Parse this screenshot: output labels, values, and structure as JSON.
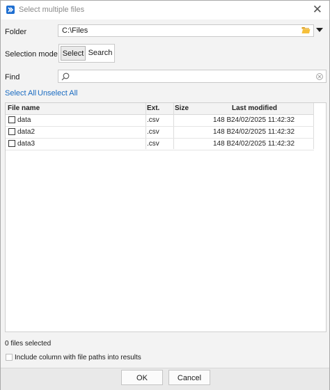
{
  "window": {
    "title": "Select multiple files",
    "close_glyph": "✕"
  },
  "folder": {
    "label": "Folder",
    "value": "C:\\Files",
    "folder_icon": "folder-open-icon",
    "dropdown_icon": "caret-down-icon"
  },
  "selection_mode": {
    "label": "Selection mode",
    "options": [
      "Select",
      "Search"
    ],
    "selected": "Select"
  },
  "find": {
    "label": "Find",
    "value": "",
    "placeholder": ""
  },
  "links": {
    "select_all": "Select All",
    "unselect_all": "Unselect All"
  },
  "table": {
    "columns": [
      "File name",
      "Ext.",
      "Size",
      "Last modified"
    ],
    "rows": [
      {
        "name": "data",
        "ext": ".csv",
        "size": "148 B",
        "modified": "24/02/2025 11:42:32",
        "checked": false
      },
      {
        "name": "data2",
        "ext": ".csv",
        "size": "148 B",
        "modified": "24/02/2025 11:42:32",
        "checked": false
      },
      {
        "name": "data3",
        "ext": ".csv",
        "size": "148 B",
        "modified": "24/02/2025 11:42:32",
        "checked": false
      }
    ]
  },
  "status": {
    "selected_count_text": "0 files selected"
  },
  "include_column": {
    "label": "Include column with file paths into results",
    "checked": false
  },
  "buttons": {
    "ok": "OK",
    "cancel": "Cancel"
  },
  "colors": {
    "accent": "#1a6bc1",
    "app_icon": "#1f6fd1"
  }
}
